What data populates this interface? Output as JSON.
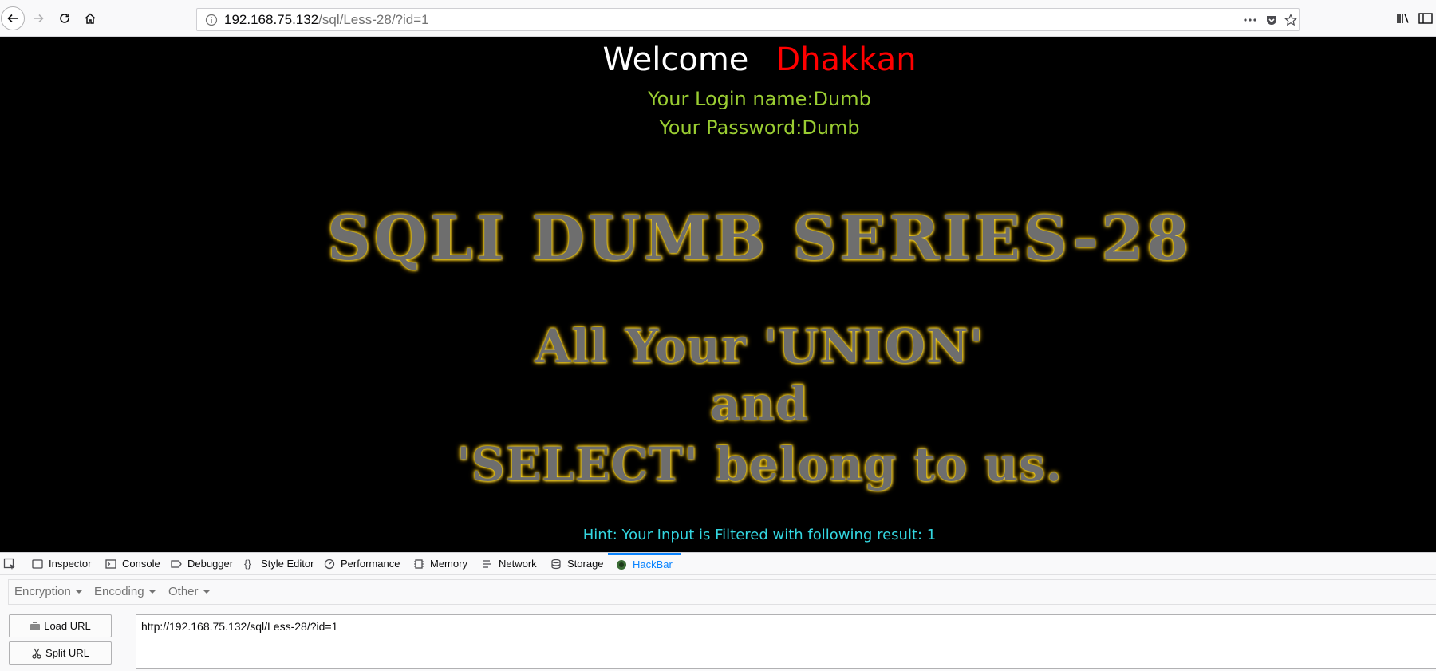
{
  "browser": {
    "url_host": "192.168.75.132",
    "url_path": "/sql/Less-28/?id=1"
  },
  "page": {
    "welcome": "Welcome",
    "name": "Dhakkan",
    "login_line": "Your Login name:Dumb",
    "password_line": "Your Password:Dumb",
    "title": "SQLI DUMB SERIES-28",
    "tagline_1": "All Your 'UNION'",
    "tagline_2": "and",
    "tagline_3": "'SELECT' belong to us.",
    "hint": "Hint: Your Input is Filtered with following result: 1",
    "colors": {
      "background": "#000000",
      "welcome": "#ffffff",
      "name": "#ff0000",
      "login": "#9acd32",
      "hint": "#33d6e0",
      "glow": "#ffd000"
    }
  },
  "devtools": {
    "tabs": [
      {
        "label": "Inspector",
        "icon": "inspector-icon"
      },
      {
        "label": "Console",
        "icon": "console-icon"
      },
      {
        "label": "Debugger",
        "icon": "debugger-icon"
      },
      {
        "label": "Style Editor",
        "icon": "style-editor-icon"
      },
      {
        "label": "Performance",
        "icon": "performance-icon"
      },
      {
        "label": "Memory",
        "icon": "memory-icon"
      },
      {
        "label": "Network",
        "icon": "network-icon"
      },
      {
        "label": "Storage",
        "icon": "storage-icon"
      },
      {
        "label": "HackBar",
        "icon": "hackbar-icon",
        "active": true
      }
    ]
  },
  "hackbar": {
    "menus": [
      "Encryption",
      "Encoding",
      "Other"
    ],
    "load_url_label": "Load URL",
    "split_url_label": "Split URL",
    "url_value": "http://192.168.75.132/sql/Less-28/?id=1"
  }
}
